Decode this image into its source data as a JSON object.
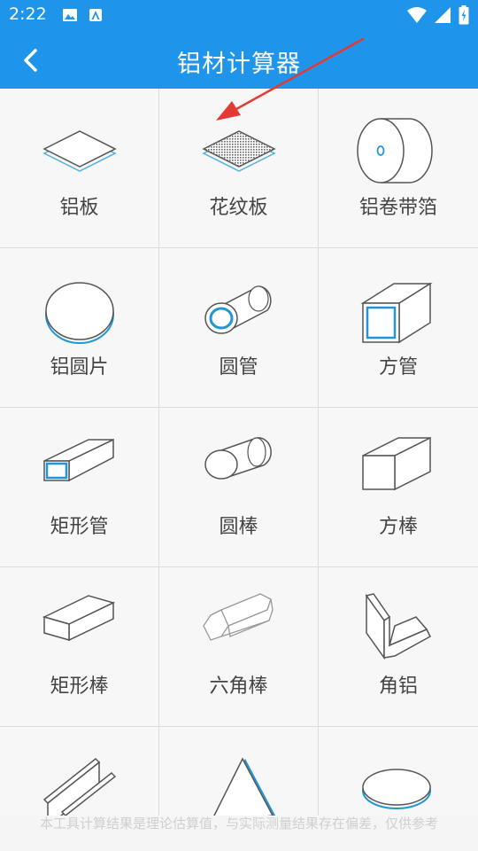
{
  "status_bar": {
    "time": "2:22",
    "left_icons": [
      "image-icon",
      "app-notification-icon"
    ],
    "right_icons": [
      "wifi-icon",
      "signal-icon",
      "battery-icon"
    ]
  },
  "header": {
    "title": "铝材计算器",
    "back_icon": "chevron-left-icon"
  },
  "calculators": [
    {
      "label": "铝板",
      "icon": "aluminum-plate-icon"
    },
    {
      "label": "花纹板",
      "icon": "patterned-plate-icon"
    },
    {
      "label": "铝卷带箔",
      "icon": "aluminum-coil-icon"
    },
    {
      "label": "铝圆片",
      "icon": "aluminum-disc-icon"
    },
    {
      "label": "圆管",
      "icon": "round-tube-icon"
    },
    {
      "label": "方管",
      "icon": "square-tube-icon"
    },
    {
      "label": "矩形管",
      "icon": "rectangular-tube-icon"
    },
    {
      "label": "圆棒",
      "icon": "round-bar-icon"
    },
    {
      "label": "方棒",
      "icon": "square-bar-icon"
    },
    {
      "label": "矩形棒",
      "icon": "rectangular-bar-icon"
    },
    {
      "label": "六角棒",
      "icon": "hexagonal-bar-icon"
    },
    {
      "label": "角铝",
      "icon": "angle-aluminum-icon"
    },
    {
      "label": "",
      "icon": "channel-aluminum-icon"
    },
    {
      "label": "",
      "icon": "triangle-icon"
    },
    {
      "label": "",
      "icon": "ellipse-disc-icon"
    }
  ],
  "footer": {
    "disclaimer": "本工具计算结果是理论估算值，与实际测量结果存在偏差，仅供参考"
  },
  "colors": {
    "primary": "#1e95ea",
    "accent_blue": "#2196d3",
    "annotation_arrow": "#e53935",
    "icon_stroke": "#555555"
  }
}
